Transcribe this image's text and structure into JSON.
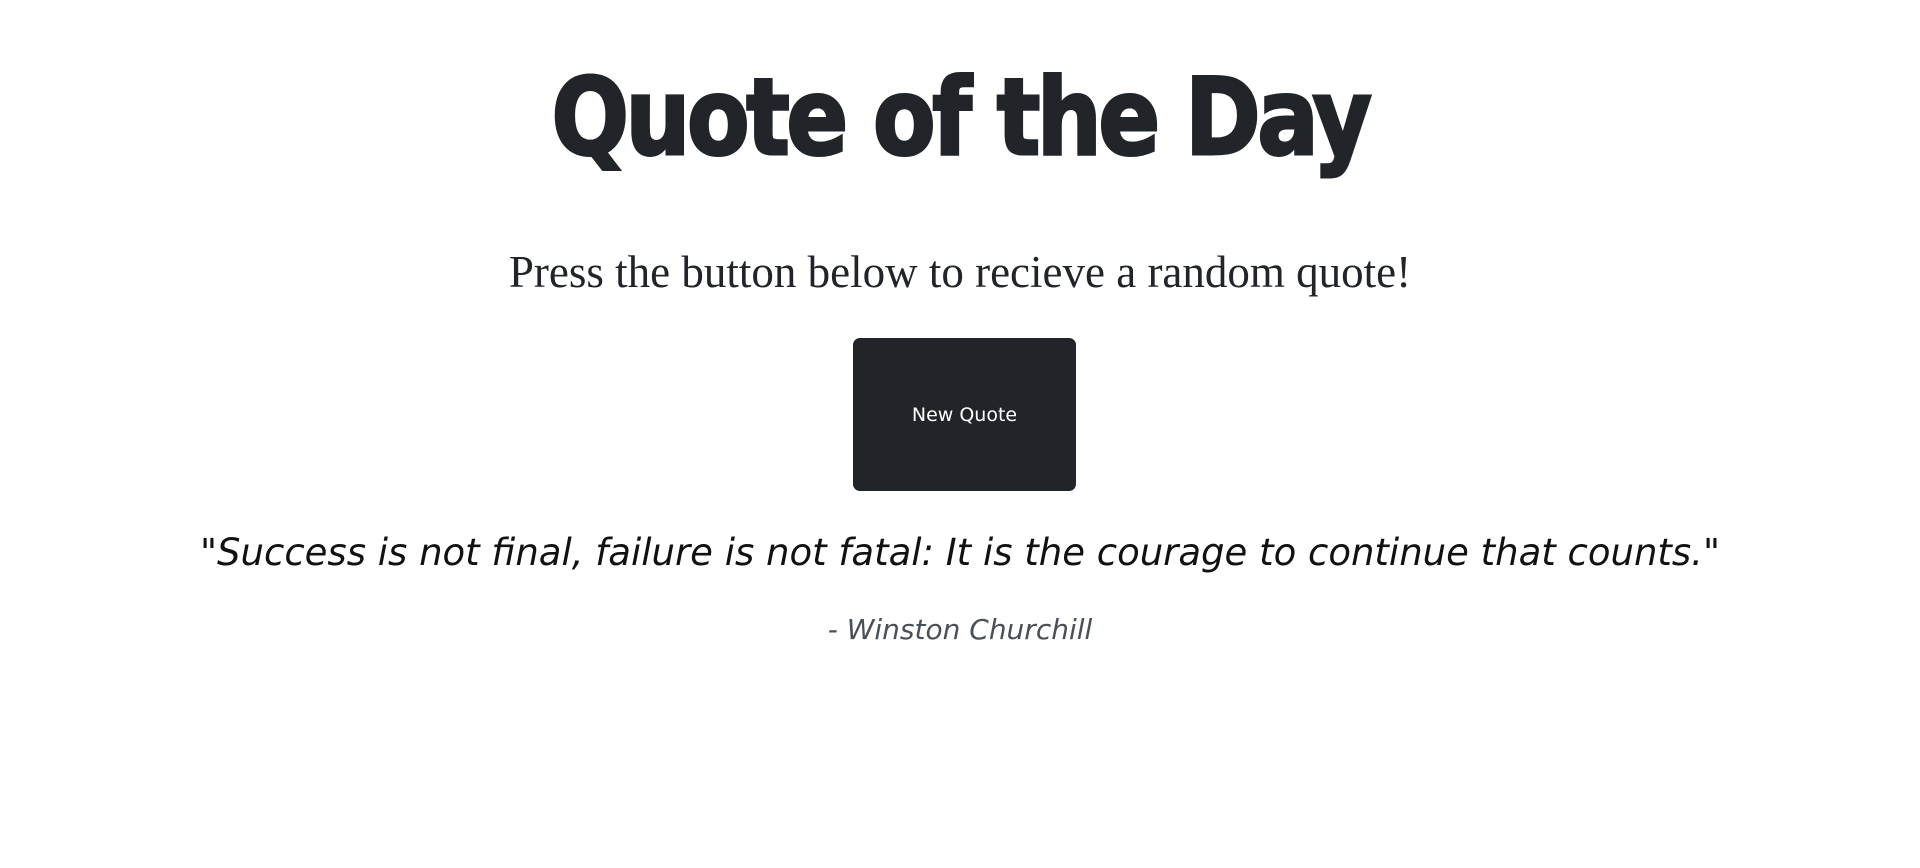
{
  "header": {
    "title": "Quote of the Day"
  },
  "intro": {
    "text": "Press the button below to recieve a random quote!"
  },
  "actions": {
    "new_quote_label": "New Quote"
  },
  "quote": {
    "text": "\"Success is not final, failure is not fatal: It is the courage to continue that counts.\"",
    "author": "- Winston Churchill"
  },
  "colors": {
    "primary_dark": "#212529",
    "background": "#ffffff",
    "muted_text": "#495057"
  }
}
